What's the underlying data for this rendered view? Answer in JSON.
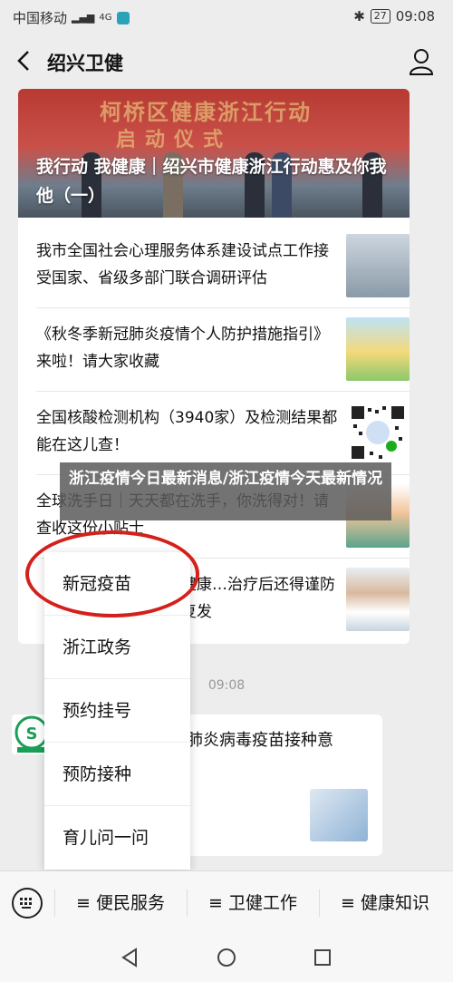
{
  "status": {
    "carrier": "中国移动",
    "signal": "4G",
    "battery": "27",
    "time": "09:08"
  },
  "header": {
    "title": "绍兴卫健",
    "back_icon": "chevron-left-icon",
    "profile_icon": "user-icon"
  },
  "article_card": {
    "banner_title": "我行动 我健康｜绍兴市健康浙江行动惠及你我他（一）",
    "banner_bg_text_1": "柯桥区健康浙江行动",
    "banner_bg_text_2": "启动仪式",
    "items": [
      {
        "title": "我市全国社会心理服务体系建设试点工作接受国家、省级多部门联合调研评估"
      },
      {
        "title": "《秋冬季新冠肺炎疫情个人防护措施指引》来啦！请大家收藏"
      },
      {
        "title": "全国核酸检测机构（3940家）及检测结果都能在这儿查！"
      },
      {
        "title": "全球洗手日｜天天都在洗手，你洗得对！请查收这份小贴士"
      },
      {
        "title": "健康…治疗后还得谨防复发"
      }
    ]
  },
  "overlay_caption": "浙江疫情今日最新消息/浙江疫情今天最新情况",
  "timestamp": "09:08",
  "message": {
    "text": "肺炎病毒疫苗接种意"
  },
  "popup_menu": {
    "items": [
      "新冠疫苗",
      "浙江政务",
      "预约挂号",
      "预防接种",
      "育儿问一问"
    ]
  },
  "bottom_menu": {
    "keyboard_icon": "keyboard-icon",
    "items": [
      "≡ 便民服务",
      "≡ 卫健工作",
      "≡ 健康知识"
    ]
  },
  "colors": {
    "highlight_circle": "#d4201b",
    "background": "#ededed"
  }
}
